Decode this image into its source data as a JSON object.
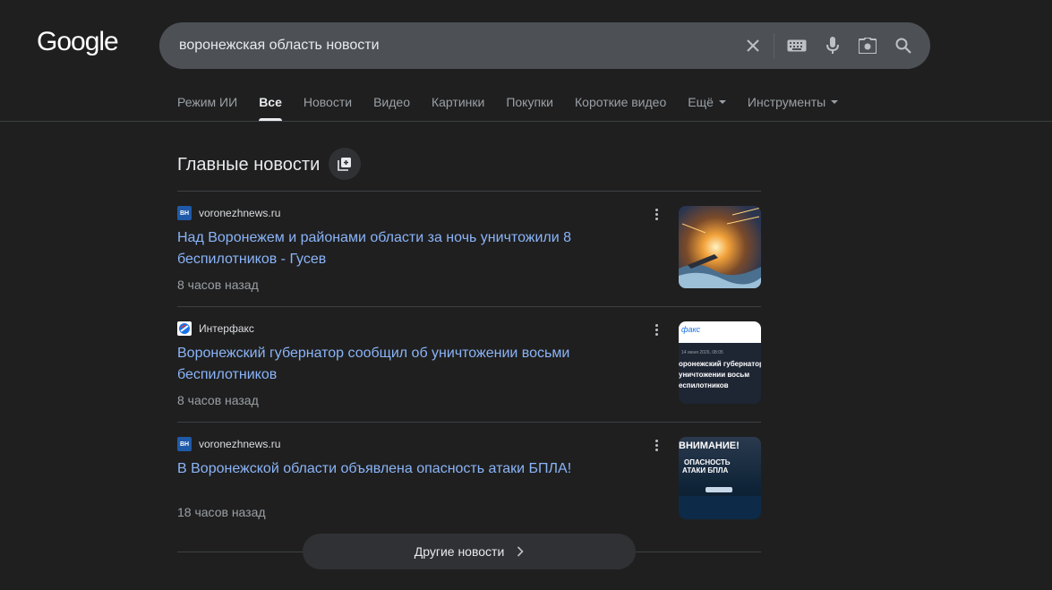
{
  "logo": {
    "text": "Google"
  },
  "search": {
    "query": "воронежская область новости"
  },
  "tabs": [
    {
      "label": "Режим ИИ"
    },
    {
      "label": "Все"
    },
    {
      "label": "Новости"
    },
    {
      "label": "Видео"
    },
    {
      "label": "Картинки"
    },
    {
      "label": "Покупки"
    },
    {
      "label": "Короткие видео"
    },
    {
      "label": "Ещё"
    },
    {
      "label": "Инструменты"
    }
  ],
  "top_stories": {
    "title": "Главные новости",
    "articles": [
      {
        "favicon_text": "ВН",
        "source": "voronezhnews.ru",
        "headline": "Над Воронежем и районами области за ночь уничтожили 8 беспилотников - Гусев",
        "age": "8 часов назад"
      },
      {
        "favicon_text": "",
        "source": "Интерфакс",
        "headline": "Воронежский губернатор сообщил об уничтожении восьми беспилотников",
        "age": "8 часов назад",
        "thumb_brand": "факс",
        "thumb_date": "14 июня 2026, 08:05",
        "thumb_lines": [
          "оронежский губернатор",
          "уничтожении восьм",
          "еспилотников"
        ]
      },
      {
        "favicon_text": "ВН",
        "source": "voronezhnews.ru",
        "headline": "В Воронежской области объявлена опасность атаки БПЛА!",
        "age": "18 часов назад",
        "thumb_lines": [
          "ВНИМАНИЕ!",
          "ОПАСНОСТЬ",
          "АТАКИ БПЛА"
        ]
      }
    ],
    "more_label": "Другие новости"
  },
  "colors": {
    "background": "#1f1f1f",
    "link": "#8ab4f8",
    "search_bg": "#4d5156"
  }
}
